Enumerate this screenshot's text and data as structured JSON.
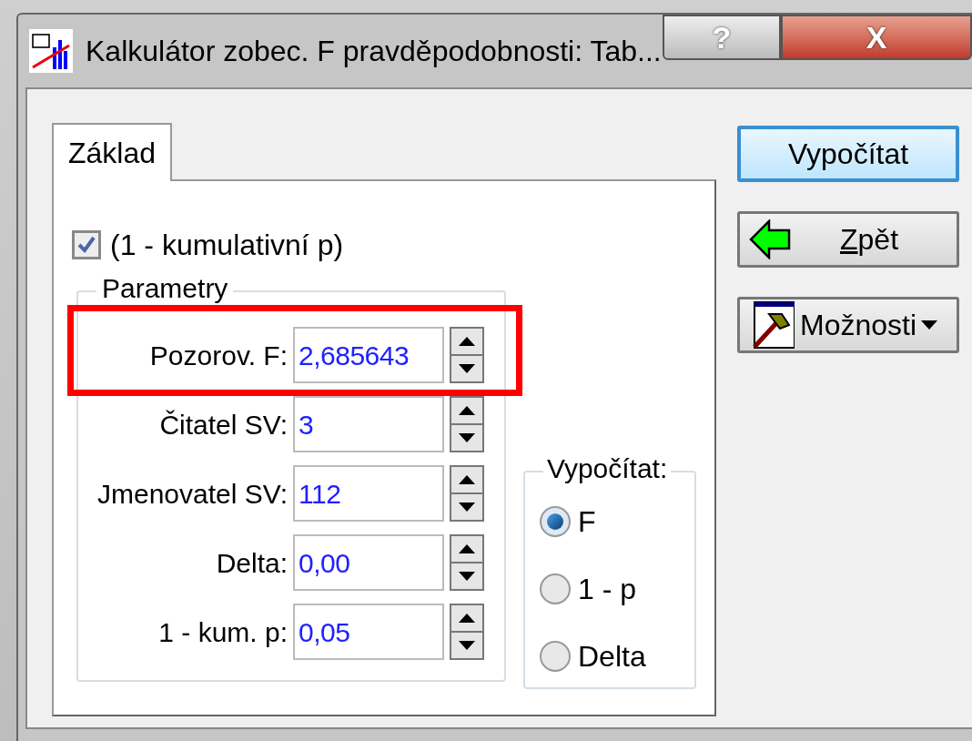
{
  "window": {
    "title": "Kalkulátor zobec. F pravděpodobnosti: Tab...",
    "buttons": [
      {
        "kind": "help",
        "label": "?"
      },
      {
        "kind": "close",
        "label": "X"
      }
    ]
  },
  "tabs": [
    {
      "label": "Základ",
      "selected": true
    }
  ],
  "checkbox": {
    "label": "(1 - kumulativní p)",
    "checked": true
  },
  "parameters": {
    "title": "Parametry",
    "fields": [
      {
        "label": "Pozorov. F:",
        "value": "2,685643",
        "highlighted": true
      },
      {
        "label": "Čitatel SV:",
        "value": "3",
        "highlighted": false
      },
      {
        "label": "Jmenovatel SV:",
        "value": "112",
        "highlighted": false
      },
      {
        "label": "Delta:",
        "value": "0,00",
        "highlighted": false
      },
      {
        "label": "1 - kum. p:",
        "value": "0,05",
        "highlighted": false
      }
    ]
  },
  "compute": {
    "title": "Vypočítat:",
    "options": [
      {
        "label": "F",
        "selected": true
      },
      {
        "label": "1 - p",
        "selected": false
      },
      {
        "label": "Delta",
        "selected": false
      }
    ]
  },
  "buttons": [
    {
      "kind": "default",
      "label": "Vypočítat",
      "underline_first": false
    },
    {
      "kind": "back",
      "label": "Zpět",
      "underline_first": true
    },
    {
      "kind": "menu",
      "label": "Možnosti",
      "underline_first": false
    }
  ]
}
